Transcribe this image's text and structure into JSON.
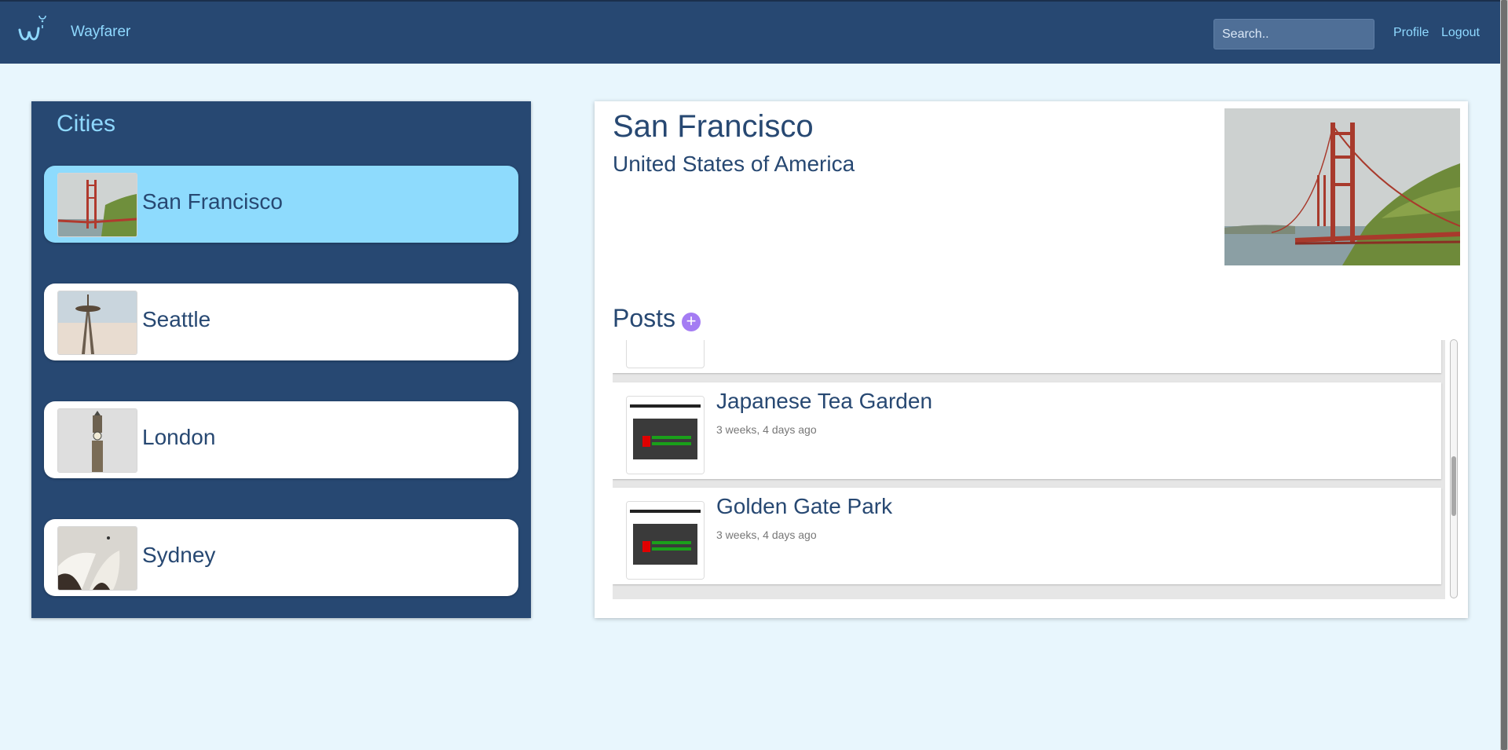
{
  "nav": {
    "brand": "Wayfarer",
    "search_placeholder": "Search..",
    "links": [
      "Profile",
      "Logout"
    ]
  },
  "sidebar": {
    "title": "Cities",
    "cities": [
      {
        "name": "San Francisco",
        "active": true
      },
      {
        "name": "Seattle",
        "active": false
      },
      {
        "name": "London",
        "active": false
      },
      {
        "name": "Sydney",
        "active": false
      }
    ]
  },
  "detail": {
    "city": "San Francisco",
    "country": "United States of America",
    "posts_title": "Posts",
    "add_label": "+",
    "posts": [
      {
        "title": "",
        "time": ""
      },
      {
        "title": "Japanese Tea Garden",
        "time": "3 weeks, 4 days ago"
      },
      {
        "title": "Golden Gate Park",
        "time": "3 weeks, 4 days ago"
      }
    ]
  },
  "colors": {
    "navy": "#274872",
    "accent": "#8fd9ff",
    "active_card": "#8edbfd",
    "add_button": "#a47cf3",
    "background": "#e8f6fd"
  }
}
